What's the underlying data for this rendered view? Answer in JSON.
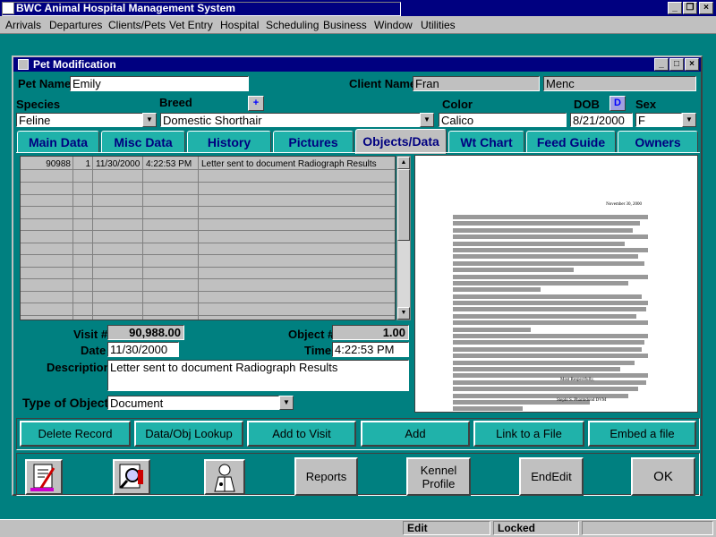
{
  "app": {
    "title": "BWC Animal Hospital Management System"
  },
  "menu": [
    "Arrivals",
    "Departures",
    "Clients/Pets",
    "Vet Entry",
    "Hospital",
    "Scheduling",
    "Business",
    "Window",
    "Utilities"
  ],
  "window": {
    "title": "Pet Modification"
  },
  "pet": {
    "name_label": "Pet Name",
    "name": "Emily",
    "client_label": "Client Name",
    "client_first": "Fran",
    "client_last": "Menc",
    "species_label": "Species",
    "species": "Feline",
    "breed_label": "Breed",
    "breed_btn": "+",
    "breed": "Domestic Shorthair",
    "color_label": "Color",
    "color": "Calico",
    "dob_label": "DOB",
    "dob_btn": "D",
    "dob": "8/21/2000",
    "sex_label": "Sex",
    "sex": "F"
  },
  "tabs": [
    "Main Data",
    "Misc Data",
    "History",
    "Pictures",
    "Objects/Data",
    "Wt Chart",
    "Feed Guide",
    "Owners"
  ],
  "active_tab": "Objects/Data",
  "grid": {
    "rows": [
      {
        "visit": "90988",
        "num": "1",
        "date": "11/30/2000",
        "time": "4:22:53 PM",
        "desc": "Letter sent to document Radiograph Results"
      }
    ],
    "empty_rows": 12
  },
  "detail": {
    "visit_label": "Visit #",
    "visit": "90,988.00",
    "object_label": "Object #",
    "object": "1.00",
    "date_label": "Date",
    "date": "11/30/2000",
    "time_label": "Time",
    "time": "4:22:53 PM",
    "desc_label": "Description",
    "desc": "Letter sent to document Radiograph Results",
    "type_label": "Type of Object",
    "type": "Document"
  },
  "document": {
    "date": "November 30, 2000",
    "closing": "Most Respectfully,",
    "signature": "Stephi S. Pharmdond DVM"
  },
  "action_buttons": [
    "Delete Record",
    "Data/Obj Lookup",
    "Add to Visit",
    "Add",
    "Link to a File",
    "Embed a file"
  ],
  "bottom_buttons": {
    "reports": "Reports",
    "kennel": "Kennel Profile",
    "endedit": "EndEdit",
    "ok": "OK"
  },
  "status": {
    "mode": "Edit",
    "lock": "Locked"
  }
}
